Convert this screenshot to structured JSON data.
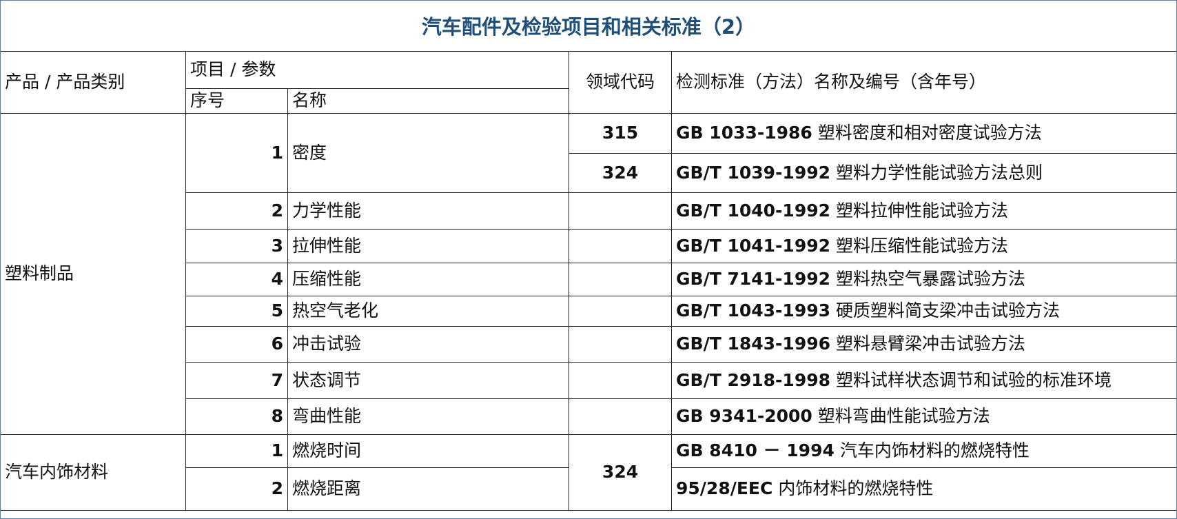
{
  "title": "汽车配件及检验项目和相关标准（2）",
  "headers": {
    "product": "产品 / 产品类别",
    "item_param": "项目 / 参数",
    "seq": "序号",
    "name": "名称",
    "domain_code": "领域代码",
    "standard": "检测标准（方法）名称及编号（含年号）"
  },
  "groups": [
    {
      "category": "塑料制品",
      "items": [
        {
          "seq": "1",
          "name": "密度"
        },
        {
          "seq": "2",
          "name": "力学性能"
        },
        {
          "seq": "3",
          "name": "拉伸性能"
        },
        {
          "seq": "4",
          "name": "压缩性能"
        },
        {
          "seq": "5",
          "name": "热空气老化"
        },
        {
          "seq": "6",
          "name": "冲击试验"
        },
        {
          "seq": "7",
          "name": "状态调节"
        },
        {
          "seq": "8",
          "name": "弯曲性能"
        }
      ],
      "standards": [
        {
          "code": "315",
          "std_code": "GB 1033-1986",
          "std_name": "塑料密度和相对密度试验方法"
        },
        {
          "code": "324",
          "std_code": "GB/T 1039-1992",
          "std_name": "塑料力学性能试验方法总则"
        },
        {
          "code": "",
          "std_code": "GB/T 1040-1992",
          "std_name": "塑料拉伸性能试验方法"
        },
        {
          "code": "",
          "std_code": "GB/T 1041-1992",
          "std_name": "塑料压缩性能试验方法"
        },
        {
          "code": "",
          "std_code": "GB/T 7141-1992",
          "std_name": "塑料热空气暴露试验方法"
        },
        {
          "code": "",
          "std_code": "GB/T 1043-1993",
          "std_name": "硬质塑料简支梁冲击试验方法"
        },
        {
          "code": "",
          "std_code": "GB/T 1843-1996",
          "std_name": "塑料悬臂梁冲击试验方法"
        },
        {
          "code": "",
          "std_code": "GB/T 2918-1998",
          "std_name": "塑料试样状态调节和试验的标准环境"
        },
        {
          "code": "",
          "std_code": "GB 9341-2000",
          "std_name": "塑料弯曲性能试验方法"
        }
      ]
    },
    {
      "category": "汽车内饰材料",
      "code": "324",
      "items": [
        {
          "seq": "1",
          "name": "燃烧时间",
          "std_code": "GB 8410 － 1994",
          "std_name": "汽车内饰材料的燃烧特性"
        },
        {
          "seq": "2",
          "name": "燃烧距离",
          "std_code": "95/28/EEC",
          "std_name": "内饰材料的燃烧特性"
        }
      ]
    }
  ],
  "colors": {
    "title": "#1f4e79",
    "grid": "#222222",
    "frame": "#5b7fa6"
  }
}
